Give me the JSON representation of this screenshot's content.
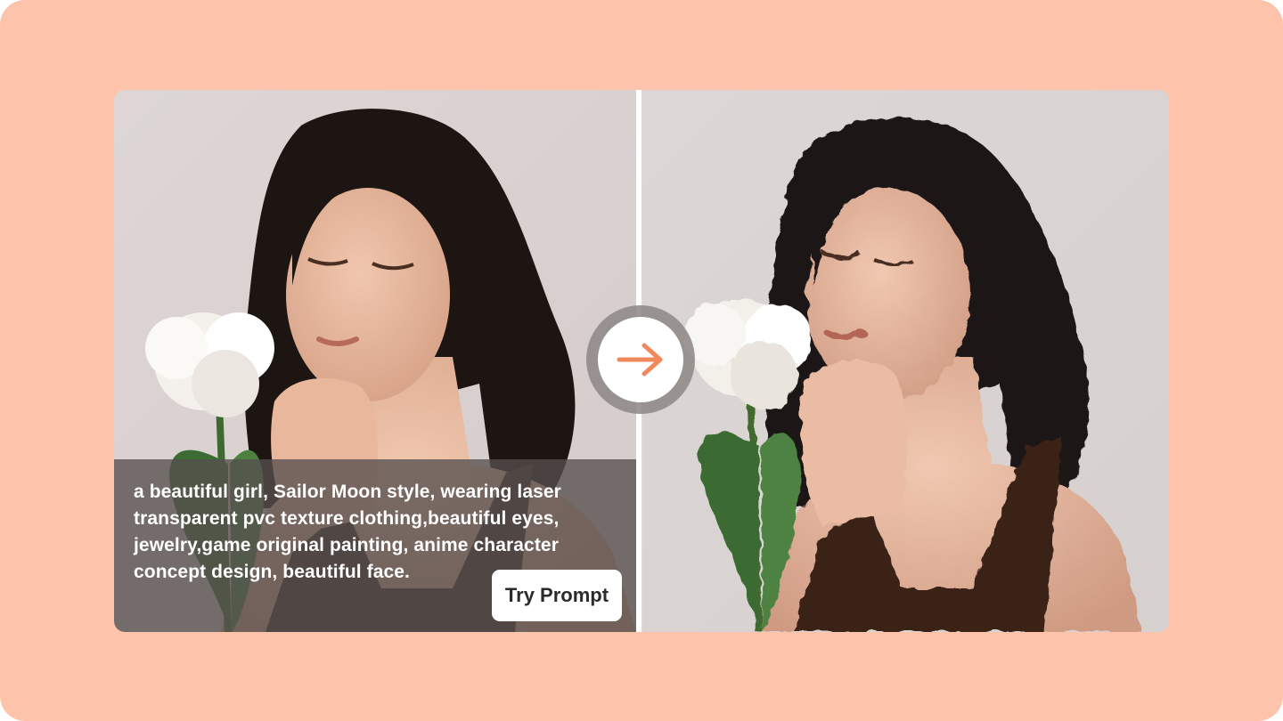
{
  "prompt": {
    "text": "a beautiful girl, Sailor Moon style, wearing laser transparent pvc texture clothing,beautiful eyes, jewelry,game original painting, anime character concept design, beautiful face.",
    "button_label": "Try Prompt"
  },
  "images": {
    "before": {
      "description_icon": "portrait-photo"
    },
    "after": {
      "description_icon": "portrait-painted"
    }
  },
  "colors": {
    "background": "#fec4ab",
    "accent_arrow": "#f0885c",
    "overlay": "#56504e"
  },
  "icons": {
    "transform": "arrow-right-icon"
  }
}
